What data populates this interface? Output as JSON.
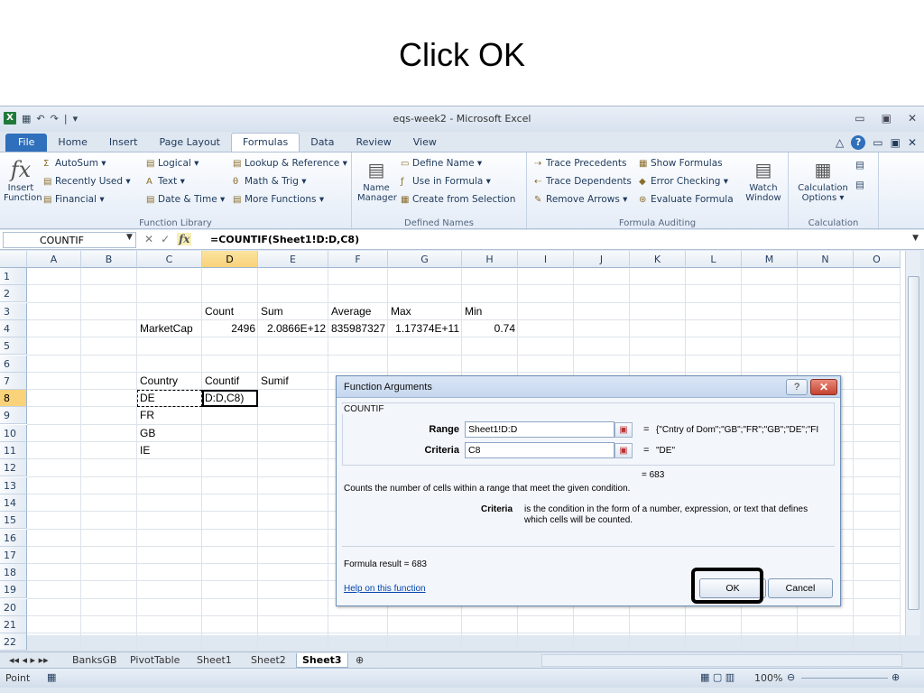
{
  "slide": {
    "title": "Click OK"
  },
  "window": {
    "title": "eqs-week2 - Microsoft Excel",
    "app_icon": "X",
    "qat": [
      "▦",
      "↶",
      "↷",
      "|",
      "▾"
    ],
    "controls": [
      "▭",
      "▣",
      "✕"
    ]
  },
  "tabs": [
    "File",
    "Home",
    "Insert",
    "Page Layout",
    "Formulas",
    "Data",
    "Review",
    "View"
  ],
  "active_tab": "Formulas",
  "tab_right": {
    "help": "?",
    "minimize": "▭",
    "restore": "▣",
    "close": "✕",
    "collapse": "△"
  },
  "ribbon": {
    "function_library": {
      "label": "Function Library",
      "insert_function": "Insert Function",
      "fx": "fx",
      "autosum": "AutoSum ▾",
      "recently_used": "Recently Used ▾",
      "financial": "Financial ▾",
      "logical": "Logical ▾",
      "text": "Text ▾",
      "date_time": "Date & Time ▾",
      "lookup": "Lookup & Reference ▾",
      "math": "Math & Trig ▾",
      "more": "More Functions ▾"
    },
    "defined_names": {
      "label": "Defined Names",
      "name_manager": "Name Manager",
      "define_name": "Define Name ▾",
      "use_in_formula": "Use in Formula ▾",
      "create_from_selection": "Create from Selection"
    },
    "formula_auditing": {
      "label": "Formula Auditing",
      "trace_precedents": "Trace Precedents",
      "trace_dependents": "Trace Dependents",
      "remove_arrows": "Remove Arrows ▾",
      "show_formulas": "Show Formulas",
      "error_checking": "Error Checking ▾",
      "evaluate_formula": "Evaluate Formula",
      "watch_window": "Watch Window"
    },
    "calculation": {
      "label": "Calculation",
      "options": "Calculation Options ▾"
    }
  },
  "formula_bar": {
    "name_box": "COUNTIF",
    "cancel": "✕",
    "enter": "✓",
    "fx": "fx",
    "formula": "=COUNTIF(Sheet1!D:D,C8)"
  },
  "grid": {
    "columns": [
      "A",
      "B",
      "C",
      "D",
      "E",
      "F",
      "G",
      "H",
      "I",
      "J",
      "K",
      "L",
      "M",
      "N",
      "O"
    ],
    "rows": [
      "1",
      "2",
      "3",
      "4",
      "5",
      "6",
      "7",
      "8",
      "9",
      "10",
      "11",
      "12",
      "13",
      "14",
      "15",
      "16",
      "17",
      "18",
      "19",
      "20",
      "21",
      "22"
    ],
    "cells": {
      "D3": "Count",
      "E3": "Sum",
      "F3": "Average",
      "G3": "Max",
      "H3": "Min",
      "C4": "MarketCap",
      "D4": "2496",
      "E4": "2.0866E+12",
      "F4": "835987327",
      "G4": "1.17374E+11",
      "H4": "0.74",
      "C7": "Country",
      "D7": "Countif",
      "E7": "Sumif",
      "C8": "DE",
      "D8": "D:D,C8)",
      "C9": "FR",
      "C10": "GB",
      "C11": "IE"
    }
  },
  "sheet_tabs": [
    "BanksGB",
    "PivotTable",
    "Sheet1",
    "Sheet2",
    "Sheet3"
  ],
  "active_sheet": "Sheet3",
  "status": {
    "mode": "Point",
    "zoom": "100%"
  },
  "dialog": {
    "title": "Function Arguments",
    "help": "?",
    "close": "✕",
    "function_name": "COUNTIF",
    "range_label": "Range",
    "range_value": "Sheet1!D:D",
    "range_result": "{\"Cntry of Dom\";\"GB\";\"FR\";\"GB\";\"DE\";\"FI",
    "criteria_label": "Criteria",
    "criteria_value": "C8",
    "criteria_result": "\"DE\"",
    "eq": "=",
    "overall_result": "= 683",
    "description": "Counts the number of cells within a range that meet the given condition.",
    "arg_help_label": "Criteria",
    "arg_help_line1": "is the condition in the form of a number, expression, or text that defines",
    "arg_help_line2": "which cells will be counted.",
    "formula_result": "Formula result =  683",
    "help_link": "Help on this function",
    "ok": "OK",
    "cancel": "Cancel"
  }
}
